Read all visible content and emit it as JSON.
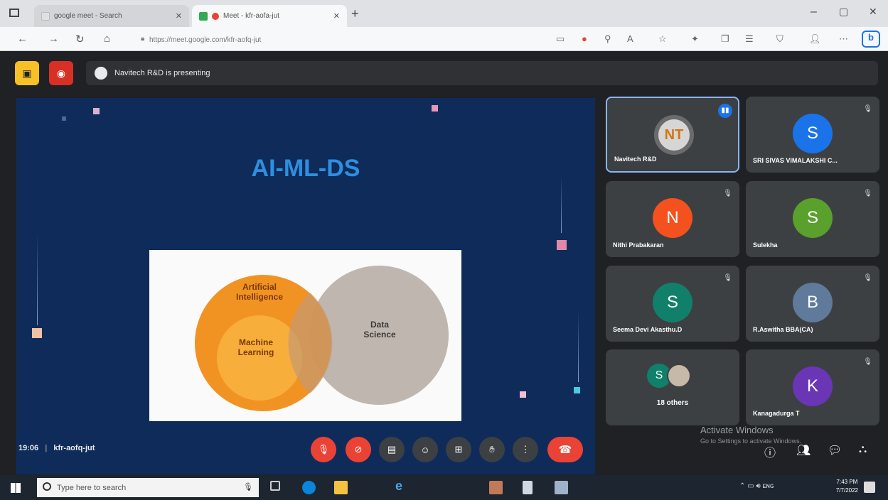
{
  "browser": {
    "tabs": [
      {
        "title": "google meet - Search"
      },
      {
        "title": "Meet - kfr-aofa-jut"
      }
    ],
    "url": "https://meet.google.com/kfr-aofq-jut"
  },
  "presenting_text": "Navitech R&D is presenting",
  "slide": {
    "title": "AI-ML-DS",
    "venn": {
      "outer_label": "Artificial Intelligence",
      "inner_label": "Machine Learning",
      "right_label": "Data Science"
    }
  },
  "participants": [
    {
      "name": "Navitech R&D",
      "initial": "NT",
      "color": "#e8e8e8",
      "active": true
    },
    {
      "name": "SRI SIVAS VIMALAKSHI C...",
      "initial": "S",
      "color": "#1a73e8"
    },
    {
      "name": "Nithi Prabakaran",
      "initial": "N",
      "color": "#f4511e"
    },
    {
      "name": "Sulekha",
      "initial": "S",
      "color": "#5aa02c"
    },
    {
      "name": "Seema Devi Akasthu.D",
      "initial": "S",
      "color": "#11806a"
    },
    {
      "name": "R.Aswitha BBA(CA)",
      "initial": "B",
      "color": "#5f7a9a"
    },
    {
      "name": "18 others",
      "initial": "S",
      "color": "#11806a"
    },
    {
      "name": "Kanagadurga T",
      "initial": "K",
      "color": "#6a36b5"
    }
  ],
  "meeting": {
    "time": "19:06",
    "code": "kfr-aofq-jut"
  },
  "watermark": {
    "title": "Activate Windows",
    "subtitle": "Go to Settings to activate Windows."
  },
  "taskbar": {
    "search_placeholder": "Type here to search",
    "time": "7:43 PM",
    "date": "7/7/2022"
  },
  "colors": {
    "slide_bg": "#0f2b5a",
    "title_blue": "#2e8fe0",
    "end_call_red": "#ea4335",
    "ai_orange": "#f08a10",
    "ds_gray": "#bfb6b0"
  }
}
